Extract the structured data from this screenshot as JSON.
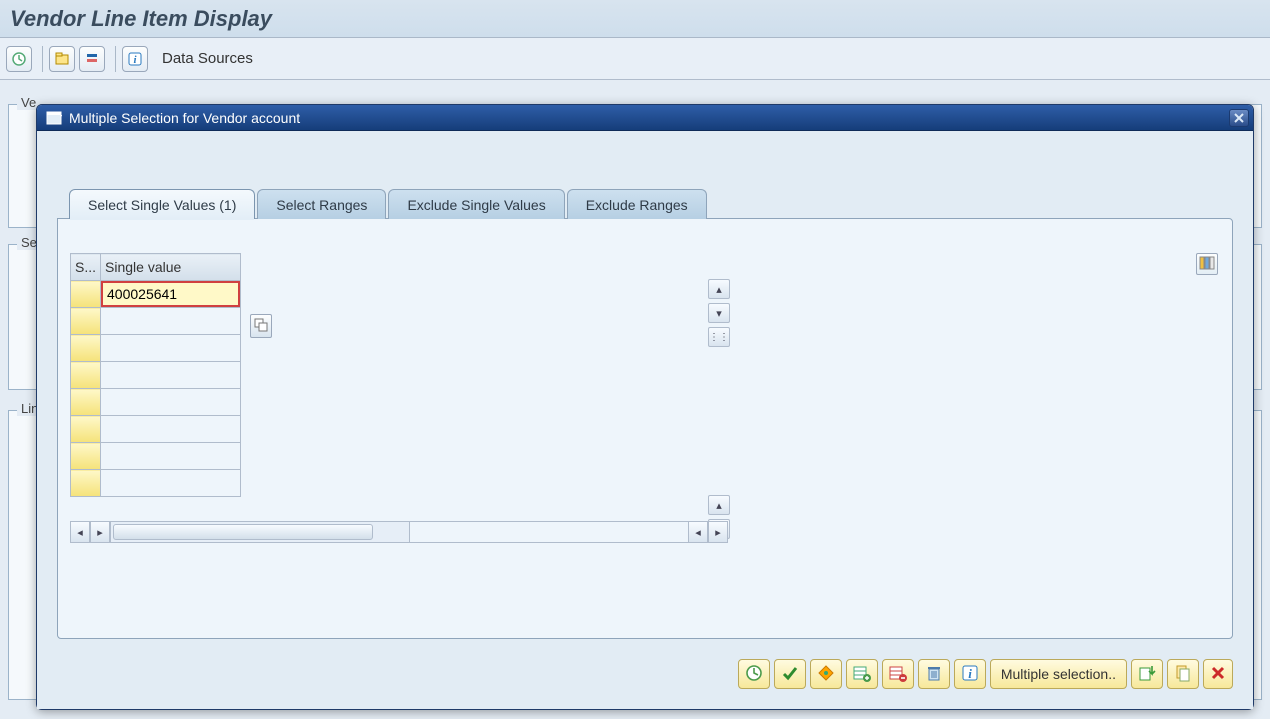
{
  "page": {
    "title": "Vendor Line Item Display"
  },
  "bg_toolbar": {
    "data_sources_label": "Data Sources"
  },
  "bg_groups": {
    "vendor": {
      "title_visible": "Ve"
    },
    "selection": {
      "title_visible": "Sel"
    },
    "line": {
      "title_visible": "Lin"
    }
  },
  "dialog": {
    "title": "Multiple Selection for Vendor account",
    "tabs": {
      "single_values": "Select Single Values (1)",
      "ranges": "Select Ranges",
      "exclude_single": "Exclude Single Values",
      "exclude_ranges": "Exclude Ranges"
    },
    "grid": {
      "col_s": "S...",
      "col_value": "Single value",
      "rows": [
        "400025641",
        "",
        "",
        "",
        "",
        "",
        "",
        ""
      ]
    },
    "toolbar": {
      "execute": "Execute",
      "check": "Check",
      "options": "Selection Options",
      "insert_row": "Insert Row",
      "delete_row": "Delete Row",
      "delete_all": "Delete All",
      "help": "Help",
      "multiple_selection": "Multiple selection..",
      "import": "Import from Text",
      "clipboard": "Upload from Clipboard",
      "cancel": "Cancel"
    }
  }
}
